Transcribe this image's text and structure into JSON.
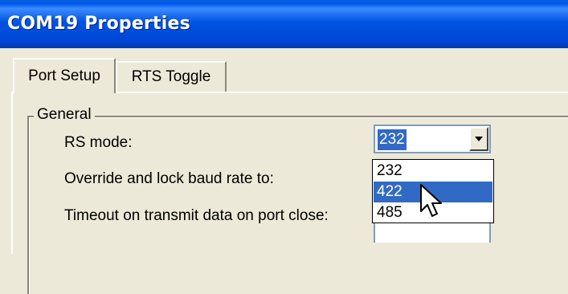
{
  "window": {
    "title": "COM19 Properties"
  },
  "tabs": [
    {
      "label": "Port Setup",
      "active": true
    },
    {
      "label": "RTS Toggle",
      "active": false
    }
  ],
  "group": {
    "label": "General"
  },
  "fields": {
    "rs_mode_label": "RS mode:",
    "override_label": "Override and lock baud rate to:",
    "timeout_label": "Timeout on transmit data on port close:"
  },
  "rs_mode": {
    "value": "232",
    "options": [
      "232",
      "422",
      "485"
    ],
    "highlighted": "422"
  },
  "colors": {
    "title_bar": "#0054e3",
    "selection": "#316ac5",
    "dialog_bg": "#ece9d8"
  },
  "icons": {
    "cursor": "mouse-pointer-icon",
    "dropdown": "chevron-down-icon"
  }
}
